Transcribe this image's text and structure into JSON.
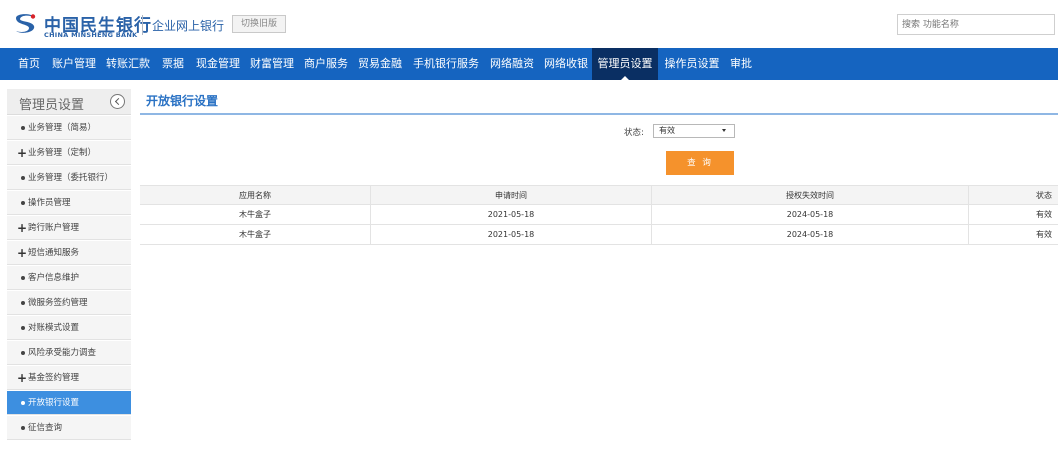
{
  "header": {
    "brand_cn": "中国民生银行",
    "brand_en": "CHINA MINSHENG BANK",
    "system_name": "企业网上银行",
    "switch_label": "切换旧版",
    "search_placeholder": "搜索 功能名称"
  },
  "nav": {
    "items": [
      {
        "label": "首页"
      },
      {
        "label": "账户管理"
      },
      {
        "label": "转账汇款"
      },
      {
        "label": "票据"
      },
      {
        "label": "现金管理"
      },
      {
        "label": "财富管理"
      },
      {
        "label": "商户服务"
      },
      {
        "label": "贸易金融"
      },
      {
        "label": "手机银行服务"
      },
      {
        "label": "网络融资"
      },
      {
        "label": "网络收银"
      },
      {
        "label": "管理员设置"
      },
      {
        "label": "操作员设置"
      },
      {
        "label": "审批"
      }
    ],
    "active_index": 11
  },
  "sidebar": {
    "title": "管理员设置",
    "items": [
      {
        "label": "业务管理（简易）",
        "type": "dot"
      },
      {
        "label": "业务管理（定制）",
        "type": "plus"
      },
      {
        "label": "业务管理（委托银行）",
        "type": "dot"
      },
      {
        "label": "操作员管理",
        "type": "dot"
      },
      {
        "label": "跨行账户管理",
        "type": "plus"
      },
      {
        "label": "短信通知服务",
        "type": "plus"
      },
      {
        "label": "客户信息维护",
        "type": "dot"
      },
      {
        "label": "微服务签约管理",
        "type": "dot"
      },
      {
        "label": "对账模式设置",
        "type": "dot"
      },
      {
        "label": "风险承受能力调查",
        "type": "dot"
      },
      {
        "label": "基金签约管理",
        "type": "plus"
      },
      {
        "label": "开放银行设置",
        "type": "dot"
      },
      {
        "label": "征信查询",
        "type": "dot"
      }
    ],
    "active_index": 11
  },
  "main": {
    "title": "开放银行设置",
    "filter": {
      "label": "状态:",
      "selected": "有效"
    },
    "query_label": "查 询",
    "table": {
      "headers": [
        "应用名称",
        "申请时间",
        "授权失效时间",
        "状态"
      ],
      "rows": [
        [
          "木牛盒子",
          "2021-05-18",
          "2024-05-18",
          "有效"
        ],
        [
          "木牛盒子",
          "2021-05-18",
          "2024-05-18",
          "有效"
        ]
      ]
    }
  },
  "colors": {
    "nav_bg": "#1564c0",
    "nav_active": "#0a2f63",
    "brand": "#2a62a8",
    "accent_orange": "#f5922c",
    "sidebar_active": "#3d8fe0"
  }
}
